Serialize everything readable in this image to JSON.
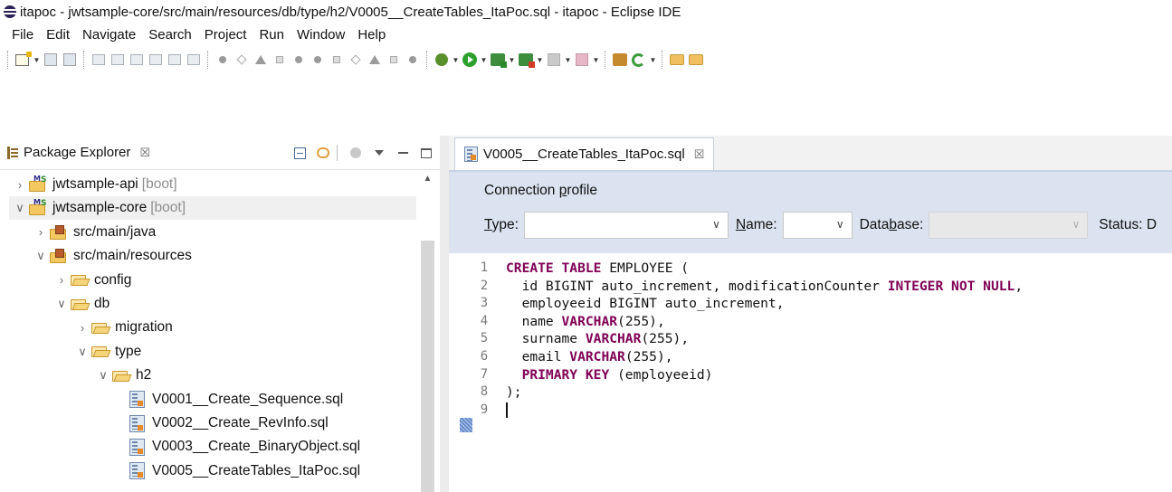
{
  "window": {
    "title": "itapoc - jwtsample-core/src/main/resources/db/type/h2/V0005__CreateTables_ItaPoc.sql - itapoc - Eclipse IDE"
  },
  "menu": [
    "File",
    "Edit",
    "Navigate",
    "Search",
    "Project",
    "Run",
    "Window",
    "Help"
  ],
  "package_explorer": {
    "tab_label": "Package Explorer",
    "close_glyph": "☒",
    "tree": [
      {
        "label": "jwtsample-api",
        "suffix": "[boot]",
        "twisty": "›",
        "icon": "project-icon",
        "level": 0
      },
      {
        "label": "jwtsample-core",
        "suffix": "[boot]",
        "twisty": "∨",
        "icon": "project-icon",
        "level": 0,
        "selected": true
      },
      {
        "label": "src/main/java",
        "twisty": "›",
        "icon": "source-folder-icon",
        "level": 1
      },
      {
        "label": "src/main/resources",
        "twisty": "∨",
        "icon": "source-folder-icon",
        "level": 1
      },
      {
        "label": "config",
        "twisty": "›",
        "icon": "folder-icon",
        "level": 2
      },
      {
        "label": "db",
        "twisty": "∨",
        "icon": "folder-icon",
        "level": 2
      },
      {
        "label": "migration",
        "twisty": "›",
        "icon": "folder-icon",
        "level": 3
      },
      {
        "label": "type",
        "twisty": "∨",
        "icon": "folder-icon",
        "level": 3
      },
      {
        "label": "h2",
        "twisty": "∨",
        "icon": "folder-icon",
        "level": 4
      },
      {
        "label": "V0001__Create_Sequence.sql",
        "twisty": "",
        "icon": "sql-file-icon",
        "level": 5
      },
      {
        "label": "V0002__Create_RevInfo.sql",
        "twisty": "",
        "icon": "sql-file-icon",
        "level": 5
      },
      {
        "label": "V0003__Create_BinaryObject.sql",
        "twisty": "",
        "icon": "sql-file-icon",
        "level": 5
      },
      {
        "label": "V0005__CreateTables_ItaPoc.sql",
        "twisty": "",
        "icon": "sql-file-icon",
        "level": 5
      }
    ]
  },
  "editor": {
    "tab_label": "V0005__CreateTables_ItaPoc.sql",
    "close_glyph": "☒",
    "connection_profile": {
      "heading": "Connection profile",
      "type_label": "Type:",
      "type_value": "",
      "name_label": "Name:",
      "name_value": "",
      "database_label": "Database:",
      "database_value": "",
      "status_label": "Status: D"
    },
    "line_numbers": [
      "1",
      "2",
      "3",
      "4",
      "5",
      "6",
      "7",
      "8",
      "9"
    ],
    "code": [
      [
        {
          "t": "CREATE TABLE",
          "k": true
        },
        {
          "t": " EMPLOYEE ("
        }
      ],
      [
        {
          "t": "  id BIGINT auto_increment, modificationCounter "
        },
        {
          "t": "INTEGER NOT NULL",
          "k": true
        },
        {
          "t": ","
        }
      ],
      [
        {
          "t": "  employeeid BIGINT auto_increment,"
        }
      ],
      [
        {
          "t": "  name "
        },
        {
          "t": "VARCHAR",
          "k": true
        },
        {
          "t": "(255),"
        }
      ],
      [
        {
          "t": "  surname "
        },
        {
          "t": "VARCHAR",
          "k": true
        },
        {
          "t": "(255),"
        }
      ],
      [
        {
          "t": "  email "
        },
        {
          "t": "VARCHAR",
          "k": true
        },
        {
          "t": "(255),"
        }
      ],
      [
        {
          "t": "  "
        },
        {
          "t": "PRIMARY KEY",
          "k": true
        },
        {
          "t": " (employeeid)"
        }
      ],
      [
        {
          "t": ");"
        }
      ],
      []
    ]
  }
}
